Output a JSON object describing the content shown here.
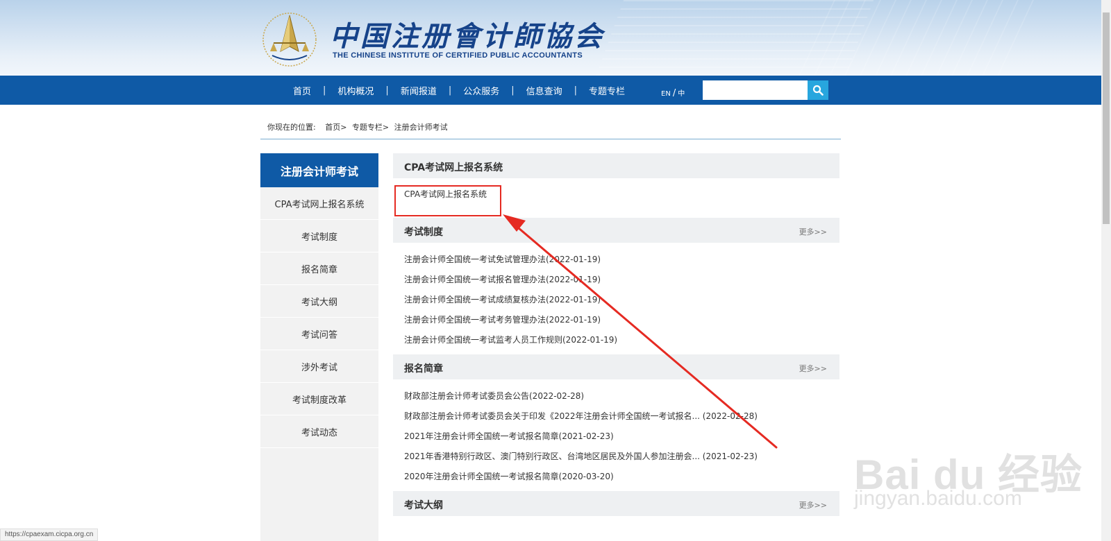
{
  "header": {
    "title_cn": "中国注册會计師協会",
    "title_en": "THE CHINESE INSTITUTE OF CERTIFIED PUBLIC ACCOUNTANTS"
  },
  "nav": {
    "items": [
      "首页",
      "机构概况",
      "新闻报道",
      "公众服务",
      "信息查询",
      "专题专栏"
    ],
    "separator": "|",
    "lang_en": "EN",
    "lang_slash": "/",
    "lang_cn": "中",
    "search_value": ""
  },
  "breadcrumb": {
    "label": "你现在的位置:",
    "path": [
      "首页>",
      "专题专栏>",
      "注册会计师考试"
    ]
  },
  "sidebar": {
    "title": "注册会计师考试",
    "items": [
      "CPA考试网上报名系统",
      "考试制度",
      "报名简章",
      "考试大纲",
      "考试问答",
      "涉外考试",
      "考试制度改革",
      "考试动态"
    ]
  },
  "main": {
    "section_cpa": {
      "title": "CPA考试网上报名系统",
      "link": "CPA考试网上报名系统"
    },
    "more_label": "更多>>",
    "section_system": {
      "title": "考试制度",
      "links": [
        "注册会计师全国统一考试免试管理办法(2022-01-19)",
        "注册会计师全国统一考试报名管理办法(2022-01-19)",
        "注册会计师全国统一考试成绩复核办法(2022-01-19)",
        "注册会计师全国统一考试考务管理办法(2022-01-19)",
        "注册会计师全国统一考试监考人员工作规则(2022-01-19)"
      ]
    },
    "section_guide": {
      "title": "报名简章",
      "links": [
        "财政部注册会计师考试委员会公告(2022-02-28)",
        "财政部注册会计师考试委员会关于印发《2022年注册会计师全国统一考试报名... (2022-02-28)",
        "2021年注册会计师全国统一考试报名简章(2021-02-23)",
        "2021年香港特别行政区、澳门特别行政区、台湾地区居民及外国人参加注册会... (2021-02-23)",
        "2020年注册会计师全国统一考试报名简章(2020-03-20)"
      ]
    },
    "section_outline": {
      "title": "考试大纲"
    }
  },
  "status_url": "https://cpaexam.cicpa.org.cn",
  "watermark": {
    "logo": "Bai du 经验",
    "url": "jingyan.baidu.com"
  },
  "colors": {
    "nav_blue": "#0f5aa6",
    "search_btn": "#27a6de",
    "highlight_red": "#e52a22"
  }
}
